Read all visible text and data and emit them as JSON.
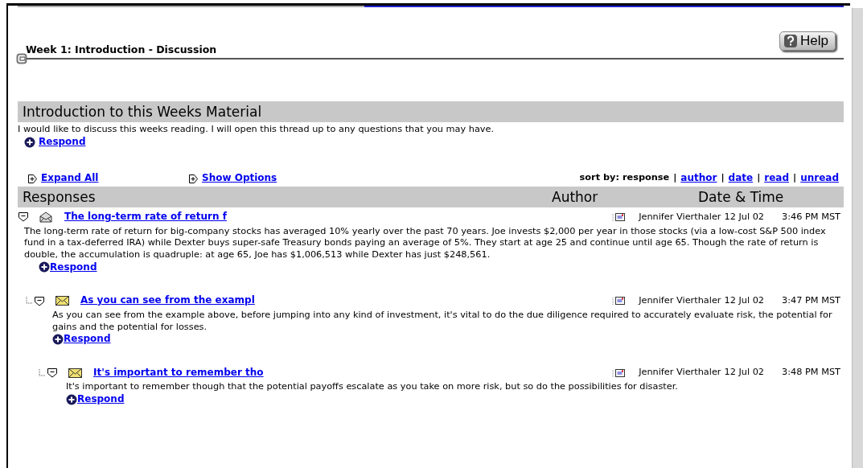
{
  "page_title": "Week 1:  Introduction - Discussion",
  "help_button": "Help",
  "topic": {
    "title": "Introduction to this Weeks Material",
    "text": "I would like to discuss this weeks reading. I will open this thread up to any questions that you may have.",
    "respond": "Respond"
  },
  "toolbar": {
    "expand_all": "Expand All",
    "show_options": "Show Options",
    "sort_label": "sort by:",
    "separator": "|",
    "sort_options": [
      {
        "label": "response",
        "selected": true
      },
      {
        "label": "author",
        "selected": false
      },
      {
        "label": "date",
        "selected": false
      },
      {
        "label": "read",
        "selected": false
      },
      {
        "label": "unread",
        "selected": false
      }
    ]
  },
  "columns": [
    "Responses",
    "Author",
    "Date & Time"
  ],
  "posts": [
    {
      "title": "The long-term rate of return f",
      "read": true,
      "expanded": true,
      "author": "Jennifer Vierthaler",
      "date": "12 Jul 02",
      "time": "3:46 PM MST",
      "text": "The long-term rate of return for big-company stocks has averaged 10% yearly over the past 70 years. Joe invests $2,000 per year in those stocks (via a low-cost S&P 500 index fund in a tax-deferred IRA) while Dexter buys super-safe Treasury bonds paying an average of 5%. They start at age 25 and continue until age 65. Though the rate of return is double, the accumulation is quadruple: at age 65, Joe has $1,006,513 while Dexter has just $248,561.",
      "respond": "Respond",
      "children": [
        {
          "title": "As you can see from the exampl",
          "read": false,
          "expanded": true,
          "author": "Jennifer Vierthaler",
          "date": "12 Jul 02",
          "time": "3:47 PM MST",
          "text": "As you can see from the example above, before jumping into any kind of investment, it's vital to do the due diligence required to accurately evaluate risk, the potential for gains and the potential for losses.",
          "respond": "Respond",
          "children": [
            {
              "title": "It's important to remember tho",
              "read": false,
              "expanded": true,
              "author": "Jennifer Vierthaler",
              "date": "12 Jul 02",
              "time": "3:48 PM MST",
              "text": "It's important to remember though that the potential payoffs escalate as you take on more risk, but so do the possibilities for disaster.",
              "respond": "Respond"
            }
          ]
        }
      ]
    }
  ]
}
